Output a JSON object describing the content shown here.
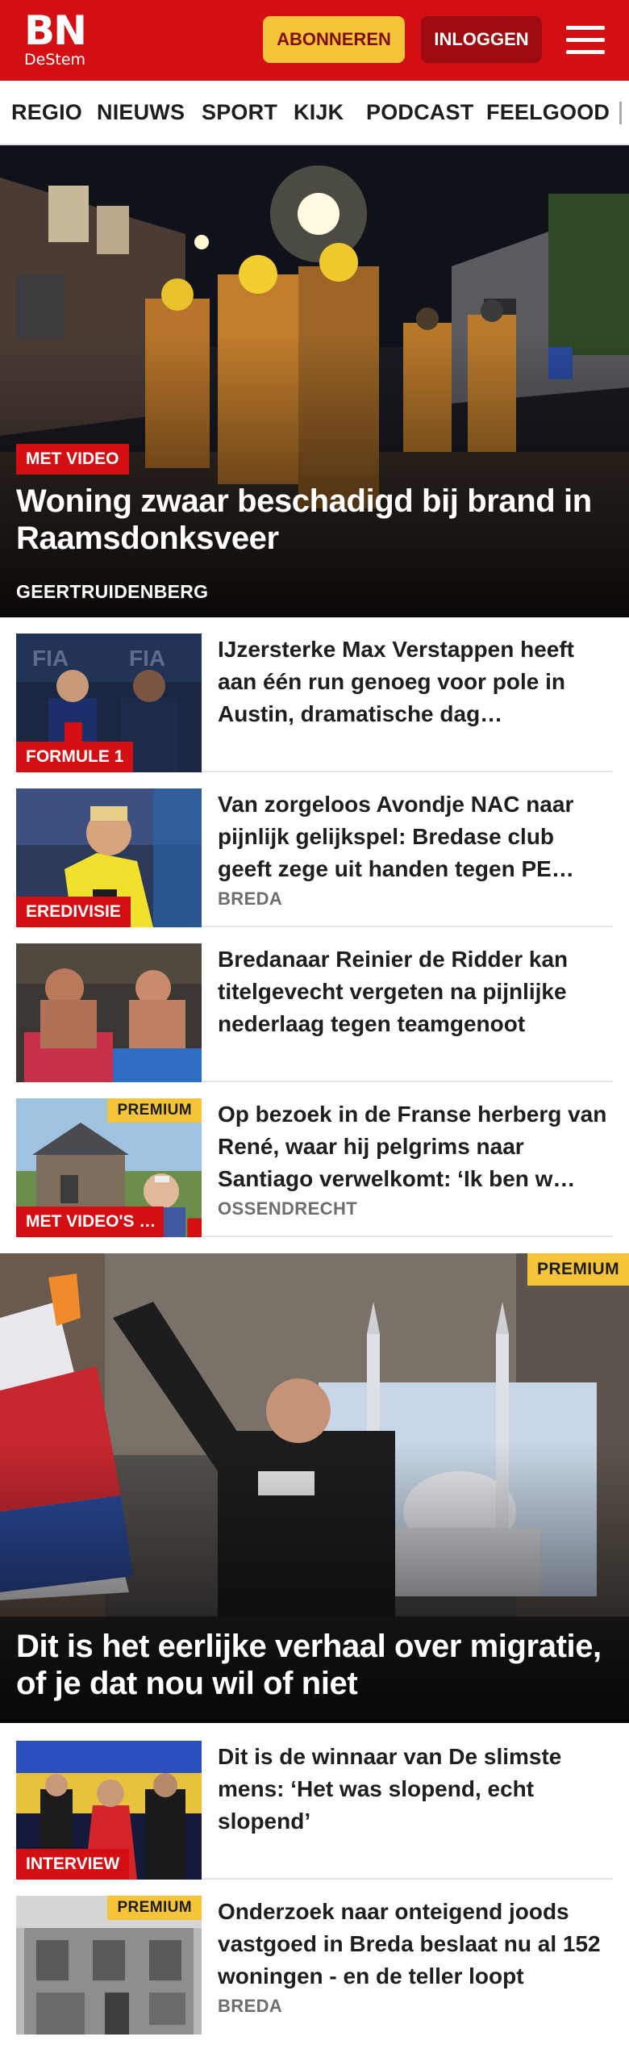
{
  "header": {
    "logo_main": "BN",
    "logo_sub": "DeStem",
    "subscribe_label": "ABONNEREN",
    "login_label": "INLOGGEN",
    "brand_color": "#d40f14",
    "accent_color": "#f5c438"
  },
  "nav": {
    "items": [
      "REGIO",
      "NIEUWS",
      "SPORT",
      "KIJK",
      "PODCAST",
      "FEELGOOD"
    ]
  },
  "hero": {
    "badge": "MET VIDEO",
    "title": "Woning zwaar beschadigd bij brand in Raamsdonksveer",
    "region": "GEERTRUIDENBERG"
  },
  "articles": [
    {
      "badge": "FORMULE 1",
      "title": "IJzersterke Max Verstappen heeft aan één run genoeg voor pole in Austin, dramatische dag…",
      "region": ""
    },
    {
      "badge": "EREDIVISIE",
      "title": "Van zorgeloos Avondje NAC naar pijnlijk gelijkspel: Bredase club geeft zege uit handen tegen PE…",
      "region": "BREDA"
    },
    {
      "badge": "",
      "title": "Bredanaar Reinier de Ridder kan titelgevecht vergeten na pijnlijke nederlaag tegen teamgenoot",
      "region": ""
    },
    {
      "badge": "MET VIDEO'S …",
      "premium": "PREMIUM",
      "title": "Op bezoek in de Franse herberg van René, waar hij pelgrims naar Santiago verwelkomt: ‘Ik ben w…",
      "region": "OSSENDRECHT",
      "icon": "comment-icon"
    }
  ],
  "feature": {
    "premium": "PREMIUM",
    "title": "Dit is het eerlijke verhaal over migratie, of je dat nou wil of niet"
  },
  "articles2": [
    {
      "badge": "INTERVIEW",
      "title": "Dit is de winnaar van De slimste mens: ‘Het was slopend, echt slopend’",
      "region": ""
    },
    {
      "premium": "PREMIUM",
      "title": "Onderzoek naar onteigend joods vastgoed in Breda beslaat nu al 152 woningen - en de teller loopt",
      "region": "BREDA"
    }
  ]
}
